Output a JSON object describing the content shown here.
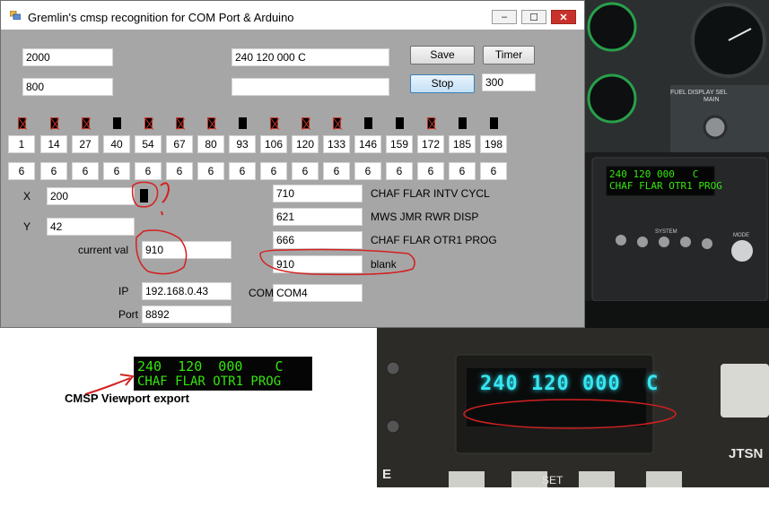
{
  "window": {
    "title": "Gremlin's cmsp recognition for COM Port & Arduino",
    "caption_buttons": [
      "–",
      "☐",
      "✕"
    ],
    "icon": "app-icon"
  },
  "fields": {
    "left_top": "2000",
    "left_second": "800",
    "display_top": "240 120 000  C",
    "display_bottom": ""
  },
  "buttons": {
    "save": "Save",
    "timer": "Timer",
    "stop": "Stop"
  },
  "timer_value": "300",
  "positions": [
    "1",
    "14",
    "27",
    "40",
    "54",
    "67",
    "80",
    "93",
    "106",
    "120",
    "133",
    "146",
    "159",
    "172",
    "185",
    "198"
  ],
  "widths": [
    "6",
    "6",
    "6",
    "6",
    "6",
    "6",
    "6",
    "6",
    "6",
    "6",
    "6",
    "6",
    "6",
    "6",
    "6",
    "6"
  ],
  "glyphs": [
    "crossed",
    "crossed",
    "crossed",
    "solid",
    "crossed",
    "crossed",
    "crossed",
    "solid",
    "crossed",
    "crossed",
    "crossed",
    "solid",
    "solid",
    "crossed",
    "solid",
    "solid"
  ],
  "coords": {
    "x_label": "X",
    "x_value": "200",
    "y_label": "Y",
    "y_value": "42"
  },
  "current_val": {
    "label": "current val",
    "value": "910"
  },
  "network": {
    "ip_label": "IP",
    "ip_value": "192.168.0.43",
    "port_label": "Port",
    "port_value": "8892",
    "com_label": "COM",
    "com_value": "COM4"
  },
  "readings": [
    {
      "value": "710",
      "label": "CHAF FLAR INTV CYCL"
    },
    {
      "value": "621",
      "label": "MWS JMR RWR DISP"
    },
    {
      "value": "666",
      "label": "CHAF FLAR  OTR1 PROG"
    },
    {
      "value": "910",
      "label": "blank"
    }
  ],
  "viewport": {
    "line1": "240  120  000    C",
    "line2": "CHAF FLAR OTR1 PROG",
    "caption": "CMSP Viewport export"
  },
  "cockpit_photo": {
    "lcd_line1": "240 120 000   C",
    "lcd_line2": "CHAF FLAR OTR1 PROG",
    "fuel_label": "FUEL DISPLAY SEL",
    "main_label": "MAIN",
    "system_label": "SYSTEM",
    "mode_label": "MODE"
  },
  "device_photo": {
    "display": "240 120 000  C",
    "jtsn": "JTSN",
    "set": "SET",
    "e": "E"
  },
  "colors": {
    "window_bg": "#a6a6a6",
    "annotation_red": "#d42020",
    "lcd_green": "#35e60e",
    "device_cyan": "#37e6f0"
  }
}
